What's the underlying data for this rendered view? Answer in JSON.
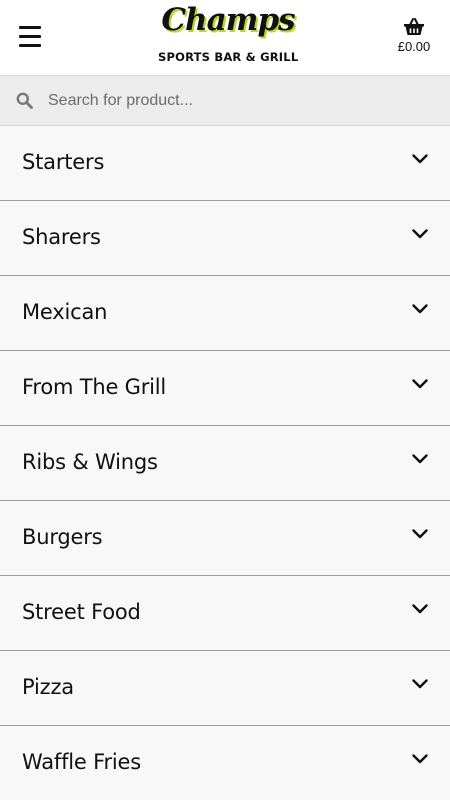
{
  "header": {
    "logo_script": "Champs",
    "logo_subtitle": "SPORTS BAR & GRILL",
    "basket_total": "£0.00"
  },
  "search": {
    "placeholder": "Search for product..."
  },
  "categories": [
    {
      "label": "Starters"
    },
    {
      "label": "Sharers"
    },
    {
      "label": "Mexican"
    },
    {
      "label": "From The Grill"
    },
    {
      "label": "Ribs & Wings"
    },
    {
      "label": "Burgers"
    },
    {
      "label": "Street Food"
    },
    {
      "label": "Pizza"
    },
    {
      "label": "Waffle Fries"
    }
  ],
  "icons": {
    "menu": "hamburger-menu-icon",
    "basket": "basket-icon",
    "search": "search-icon",
    "expand": "chevron-down-icon"
  },
  "colors": {
    "header_bg": "#ffffff",
    "search_bg": "#ececec",
    "list_bg": "#f8f8f8",
    "logo_accent": "#b8d62c",
    "text": "#111111"
  }
}
